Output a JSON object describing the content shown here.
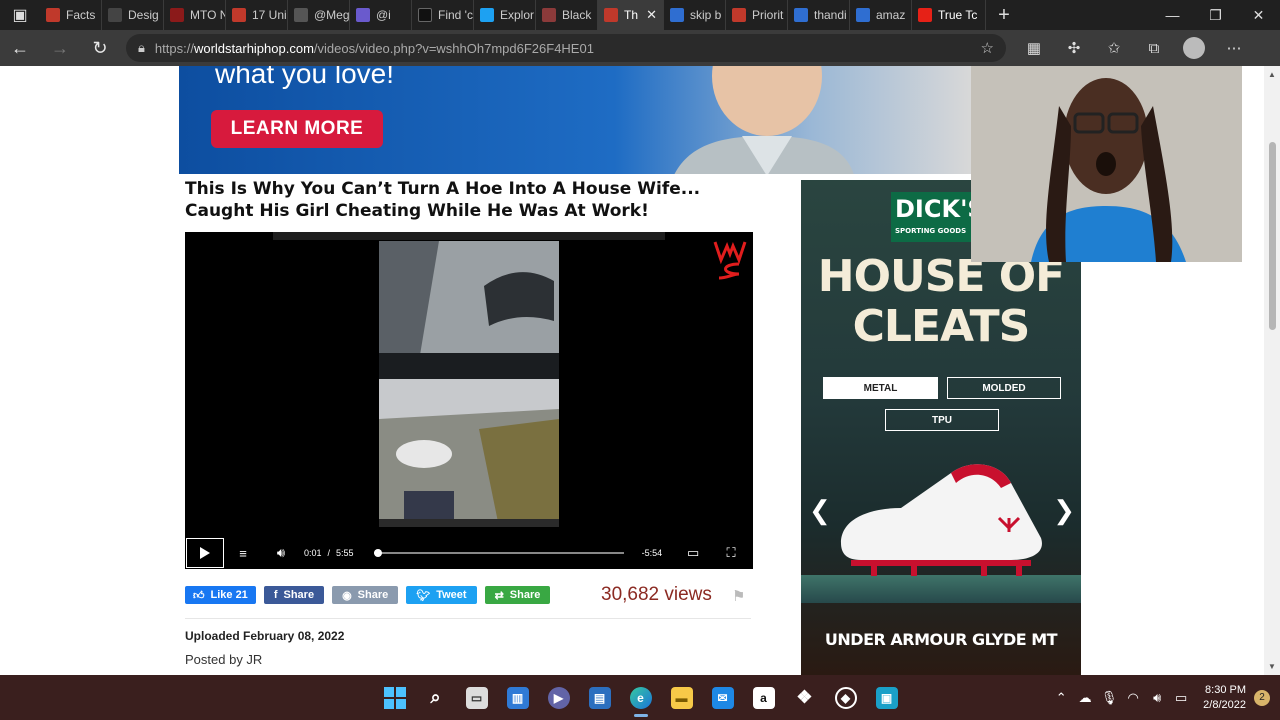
{
  "browser": {
    "tabs": [
      {
        "label": "Facts",
        "color": "#c0392b"
      },
      {
        "label": "Desig",
        "color": "#444"
      },
      {
        "label": "MTO N",
        "color": "#8b1a1a"
      },
      {
        "label": "17 Uni",
        "color": "#c0392b"
      },
      {
        "label": "@Meg",
        "color": "#555"
      },
      {
        "label": "@i",
        "color": "#6a5acd"
      },
      {
        "label": "Find 'c",
        "color": "#111"
      },
      {
        "label": "Explor",
        "color": "#1da1f2"
      },
      {
        "label": "Black",
        "color": "#8b3a3a"
      },
      {
        "label": "Th",
        "color": "#c0392b",
        "active": true
      },
      {
        "label": "skip b",
        "color": "#2f6ed1"
      },
      {
        "label": "Priorit",
        "color": "#c0392b"
      },
      {
        "label": "thandi",
        "color": "#2f6ed1"
      },
      {
        "label": "amaz",
        "color": "#2f6ed1"
      },
      {
        "label": "True Tc",
        "color": "#e62117"
      }
    ],
    "url_scheme": "https://",
    "url_host": "worldstarhiphop.com",
    "url_path": "/videos/video.php?v=wshhOh7mpd6F26F4HE01"
  },
  "banner": {
    "tagline": "what you love!",
    "cta_label": "LEARN MORE"
  },
  "video": {
    "title_line1": "This Is Why You Can’t Turn A Hoe Into A House Wife...",
    "title_line2": "Caught His Girl Cheating While He Was At Work!",
    "current_time": "0:01",
    "duration": "5:55",
    "remaining": "-5:54",
    "progress": 0.003
  },
  "social": {
    "like_label": "Like 21",
    "fb_share_label": "Share",
    "reddit_share_label": "Share",
    "tweet_label": "Tweet",
    "green_share_label": "Share",
    "views": "30,682 views"
  },
  "meta": {
    "uploaded": "Uploaded February 08, 2022",
    "posted_by": "Posted by JR"
  },
  "ad": {
    "brand": "DICK'S",
    "brand_sub": "SPORTING GOODS",
    "headline_1": "HOUSE OF",
    "headline_2": "CLEATS",
    "options": [
      "METAL",
      "MOLDED",
      "TPU"
    ],
    "footer": "UNDER ARMOUR GLYDE MT",
    "prev_arrow": "❮",
    "next_arrow": "❯"
  },
  "taskbar": {
    "time": "8:30 PM",
    "date": "2/8/2022",
    "notifications": "2"
  },
  "colors": {
    "accent_red": "#d71a3d",
    "views_color": "#8b2a22",
    "taskbar_bg": "#3a1f1e"
  }
}
